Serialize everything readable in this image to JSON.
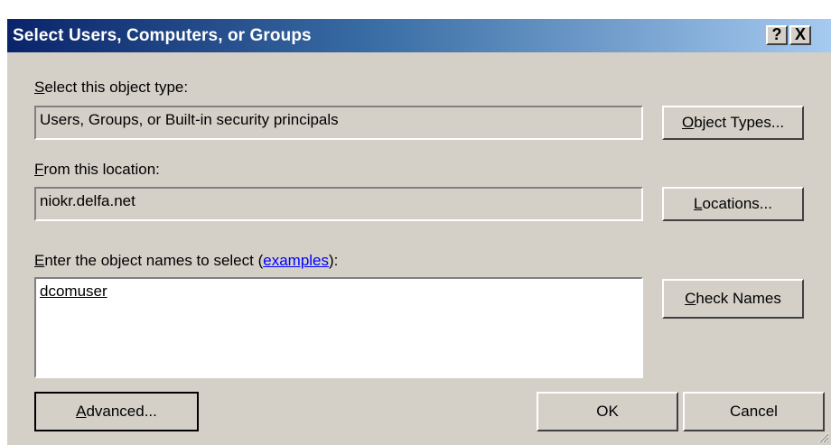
{
  "window": {
    "title": "Select Users, Computers, or Groups",
    "help_glyph": "?",
    "close_glyph": "X"
  },
  "object_type": {
    "label_mnemonic": "S",
    "label_rest": "elect this object type:",
    "value": "Users, Groups, or Built-in security principals",
    "button_mnemonic": "O",
    "button_rest": "bject Types..."
  },
  "location": {
    "label_mnemonic": "F",
    "label_rest": "rom this location:",
    "value": "niokr.delfa.net",
    "button_mnemonic": "L",
    "button_rest": "ocations..."
  },
  "names": {
    "label_mnemonic": "E",
    "label_rest": "nter the object names to select (",
    "label_link": "examples",
    "label_end": "):",
    "value": "dcomuser",
    "check_button_mnemonic": "C",
    "check_button_rest": "heck Names"
  },
  "footer": {
    "advanced_pre": "",
    "advanced_mnemonic": "A",
    "advanced_rest": "dvanced...",
    "ok_label": "OK",
    "cancel_label": "Cancel"
  },
  "colors": {
    "dialog_bg": "#d4d0c8",
    "titlebar_start": "#0a246a",
    "titlebar_end": "#a6caf0",
    "link": "#0000ff"
  }
}
